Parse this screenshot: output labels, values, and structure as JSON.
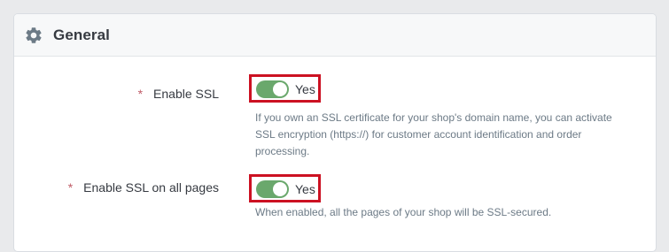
{
  "panel": {
    "title": "General",
    "icon": "gear-icon"
  },
  "settings": [
    {
      "required_mark": "*",
      "label": "Enable SSL",
      "toggle_state": "Yes",
      "enabled": true,
      "help": "If you own an SSL certificate for your shop's domain name, you can activate SSL encryption (https://) for customer account identification and order processing."
    },
    {
      "required_mark": "*",
      "label": "Enable SSL on all pages",
      "toggle_state": "Yes",
      "enabled": true,
      "help": "When enabled, all the pages of your shop will be SSL-secured."
    }
  ],
  "colors": {
    "toggle_on": "#6aa86c",
    "highlight_border": "#cc1122",
    "required": "#c05c67"
  }
}
